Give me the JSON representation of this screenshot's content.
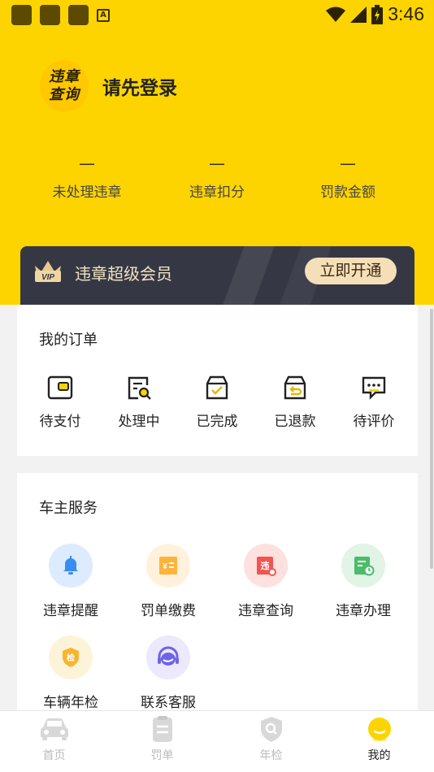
{
  "status_bar": {
    "time": "3:46",
    "badge_letter": "A"
  },
  "profile": {
    "avatar_line1": "违章",
    "avatar_line2": "查询",
    "login_prompt": "请先登录"
  },
  "stats": [
    {
      "value": "—",
      "label": "未处理违章"
    },
    {
      "value": "—",
      "label": "违章扣分"
    },
    {
      "value": "—",
      "label": "罚款金额"
    }
  ],
  "vip": {
    "badge": "VIP",
    "title": "违章超级会员",
    "button": "立即开通"
  },
  "orders": {
    "title": "我的订单",
    "items": [
      {
        "label": "待支付",
        "icon": "wallet-icon"
      },
      {
        "label": "处理中",
        "icon": "search-doc-icon"
      },
      {
        "label": "已完成",
        "icon": "box-check-icon"
      },
      {
        "label": "已退款",
        "icon": "box-return-icon"
      },
      {
        "label": "待评价",
        "icon": "comment-icon"
      }
    ]
  },
  "services": {
    "title": "车主服务",
    "items": [
      {
        "label": "违章提醒",
        "icon": "bell-icon",
        "color": "#3a8cf0"
      },
      {
        "label": "罚单缴费",
        "icon": "ticket-icon",
        "color": "#ffb33d"
      },
      {
        "label": "违章查询",
        "icon": "violation-search-icon",
        "color": "#f2544f"
      },
      {
        "label": "违章办理",
        "icon": "document-clock-icon",
        "color": "#4cbb6a"
      },
      {
        "label": "车辆年检",
        "icon": "shield-check-icon",
        "color": "#f7b52e",
        "glyph": "检"
      },
      {
        "label": "联系客服",
        "icon": "headset-icon",
        "color": "#6f63e8"
      }
    ]
  },
  "bottom_nav": [
    {
      "label": "首页",
      "icon": "car-icon"
    },
    {
      "label": "罚单",
      "icon": "clipboard-icon"
    },
    {
      "label": "年检",
      "icon": "shield-search-icon"
    },
    {
      "label": "我的",
      "icon": "profile-icon",
      "active": true
    }
  ]
}
